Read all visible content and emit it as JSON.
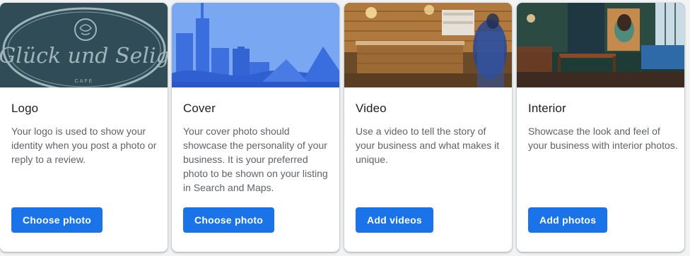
{
  "cards": [
    {
      "title": "Logo",
      "description": "Your logo is used to show your identity when you post a photo or reply to a review.",
      "button": "Choose photo",
      "image": {
        "type": "logo",
        "logo_text": "Glück und Selig",
        "logo_subtext": "CAFE",
        "background": "#33505a"
      }
    },
    {
      "title": "Cover",
      "description": "Your cover photo should showcase the personality of your business. It is your preferred photo to be shown on your listing in Search and Maps.",
      "button": "Choose photo",
      "image": {
        "type": "cover-illustration",
        "background": "#7aa7f2"
      }
    },
    {
      "title": "Video",
      "description": "Use a video to tell the story of your business and what makes it unique.",
      "button": "Add videos",
      "image": {
        "type": "cafe-counter-photo"
      }
    },
    {
      "title": "Interior",
      "description": "Showcase the look and feel of your business with interior photos.",
      "button": "Add photos",
      "image": {
        "type": "cafe-interior-photo"
      }
    }
  ],
  "colors": {
    "primary_button": "#1a73e8",
    "title_text": "#202124",
    "body_text": "#5f6368"
  }
}
